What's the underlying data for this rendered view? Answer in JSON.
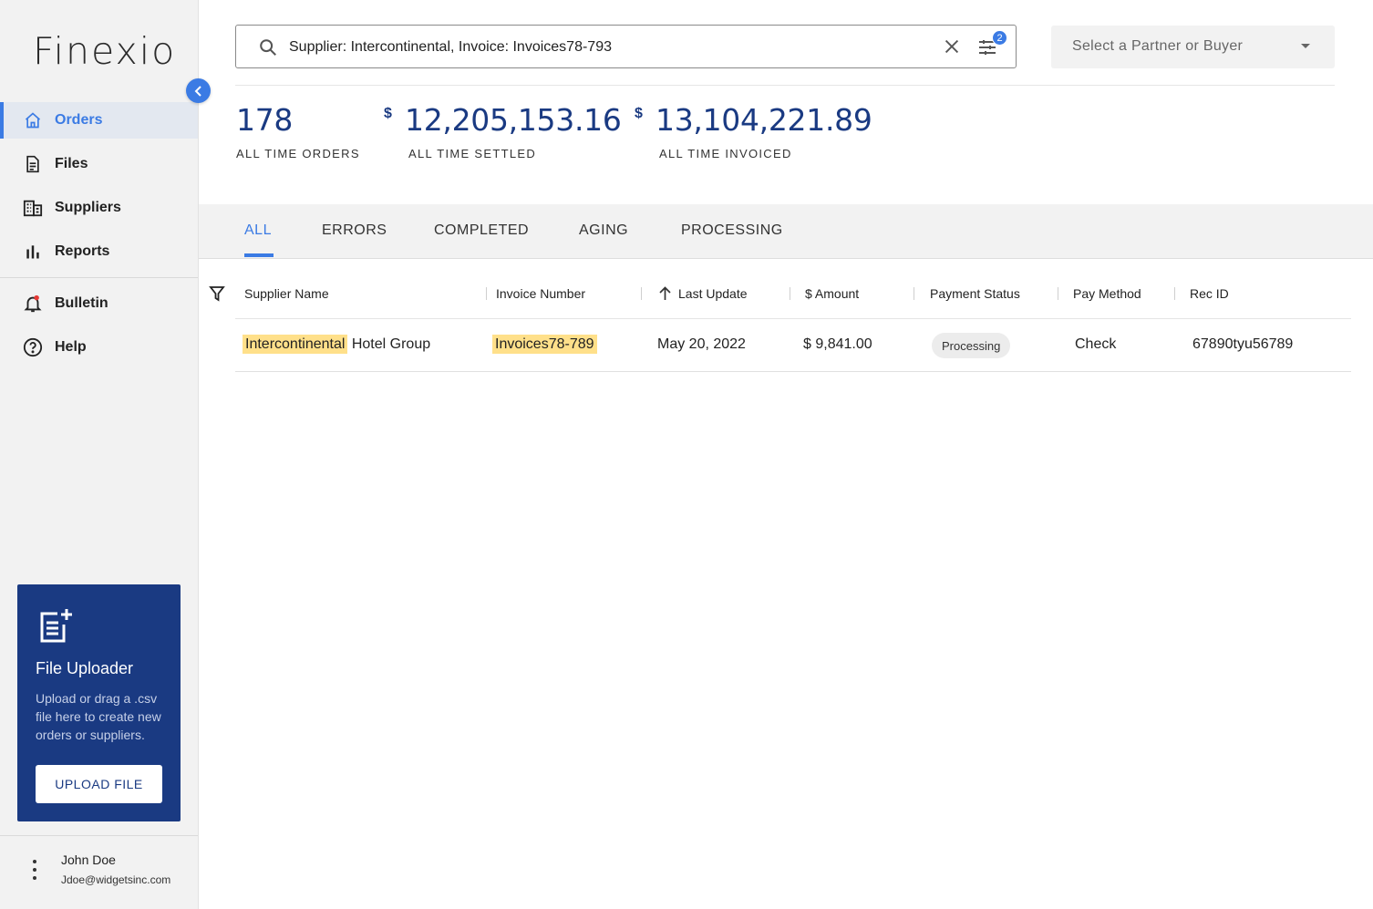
{
  "brand": {
    "logo": "Finexio"
  },
  "sidebar": {
    "items": [
      {
        "label": "Orders",
        "icon": "home-icon"
      },
      {
        "label": "Files",
        "icon": "file-icon"
      },
      {
        "label": "Suppliers",
        "icon": "building-icon"
      },
      {
        "label": "Reports",
        "icon": "bar-chart-icon"
      },
      {
        "label": "Bulletin",
        "icon": "bell-icon"
      },
      {
        "label": "Help",
        "icon": "help-icon"
      }
    ],
    "active": "Orders",
    "accent_color": "#3b7be4"
  },
  "uploader": {
    "title": "File Uploader",
    "description": "Upload or drag a .csv file here to create new orders or suppliers.",
    "button_label": "UPLOAD FILE",
    "bg_color": "#1a3a82"
  },
  "user": {
    "name": "John Doe",
    "email": "Jdoe@widgetsinc.com"
  },
  "search": {
    "value": "Supplier: Intercontinental, Invoice: Invoices78-793",
    "filter_count": "2"
  },
  "partner_select": {
    "placeholder": "Select a Partner or Buyer"
  },
  "stats": [
    {
      "value": "178",
      "currency": "",
      "label": "ALL TIME ORDERS"
    },
    {
      "value": "12,205,153.16",
      "currency": "$",
      "label": "ALL TIME SETTLED"
    },
    {
      "value": "13,104,221.89",
      "currency": "$",
      "label": "ALL TIME INVOICED"
    }
  ],
  "tabs": [
    {
      "label": "ALL",
      "active": true
    },
    {
      "label": "ERRORS"
    },
    {
      "label": "COMPLETED"
    },
    {
      "label": "AGING"
    },
    {
      "label": "PROCESSING"
    }
  ],
  "table": {
    "columns": [
      "Supplier Name",
      "Invoice Number",
      "Last Update",
      "$ Amount",
      "Payment Status",
      "Pay Method",
      "Rec ID"
    ],
    "rows": [
      {
        "supplier_highlight": "Intercontinental",
        "supplier_rest": " Hotel Group",
        "invoice": "Invoices78-789",
        "last_update": "May 20, 2022",
        "amount": "$ 9,841.00",
        "status": "Processing",
        "pay_method": "Check",
        "rec_id": "67890tyu56789"
      }
    ]
  }
}
